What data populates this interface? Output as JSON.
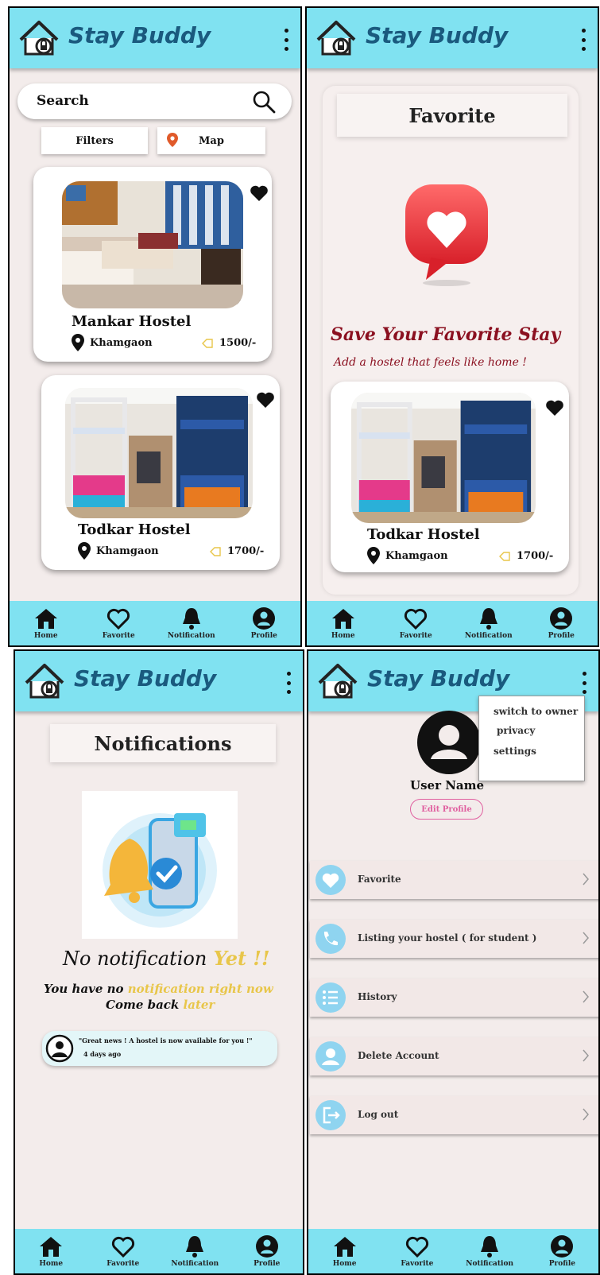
{
  "app": {
    "title": "Stay Buddy"
  },
  "nav": {
    "home": "Home",
    "favorite": "Favorite",
    "notification": "Notification",
    "profile": "Profile"
  },
  "colors": {
    "primary": "#80e2f1",
    "background": "#f3eceb",
    "title_text": "#1a5a7e",
    "accent_red": "#8b1020",
    "accent_gold": "#e8c64a",
    "edit_pink": "#e060a0"
  },
  "icons": [
    "home-icon",
    "heart-outline-icon",
    "bell-icon",
    "user-circle-icon",
    "search-icon",
    "map-pin-icon",
    "location-pin-icon",
    "price-tag-icon",
    "heart-filled-icon",
    "chevron-right-icon",
    "more-vertical-icon"
  ],
  "home": {
    "search_placeholder": "Search",
    "filters": "Filters",
    "map": "Map",
    "listings": [
      {
        "name": "Mankar Hostel",
        "location": "Khamgaon",
        "price": "1500/-"
      },
      {
        "name": "Todkar Hostel",
        "location": "Khamgaon",
        "price": "1700/-"
      }
    ]
  },
  "favorite": {
    "heading": "Favorite",
    "tagline_1": "Save Your Favorite Stay",
    "tagline_2": "Add a hostel that feels like home !",
    "listing": {
      "name": "Todkar Hostel",
      "location": "Khamgaon",
      "price": "1700/-"
    }
  },
  "notifications": {
    "heading": "Notifications",
    "empty_title_a": "No notification",
    "empty_title_b": " Yet !!",
    "empty_line1_a": "You have no ",
    "empty_line1_b": "notification right now",
    "empty_line2_a": "Come back ",
    "empty_line2_b": "later",
    "item": {
      "text": "\"Great news ! A hostel is now available for you !\"",
      "time": "4 days ago"
    }
  },
  "profile": {
    "username": "User Name",
    "edit": "Edit Profile",
    "menu": [
      "switch to owner",
      "privacy",
      "settings"
    ],
    "items": [
      "Favorite",
      "Listing your hostel ( for student )",
      "History",
      "Delete Account",
      "Log out"
    ]
  }
}
